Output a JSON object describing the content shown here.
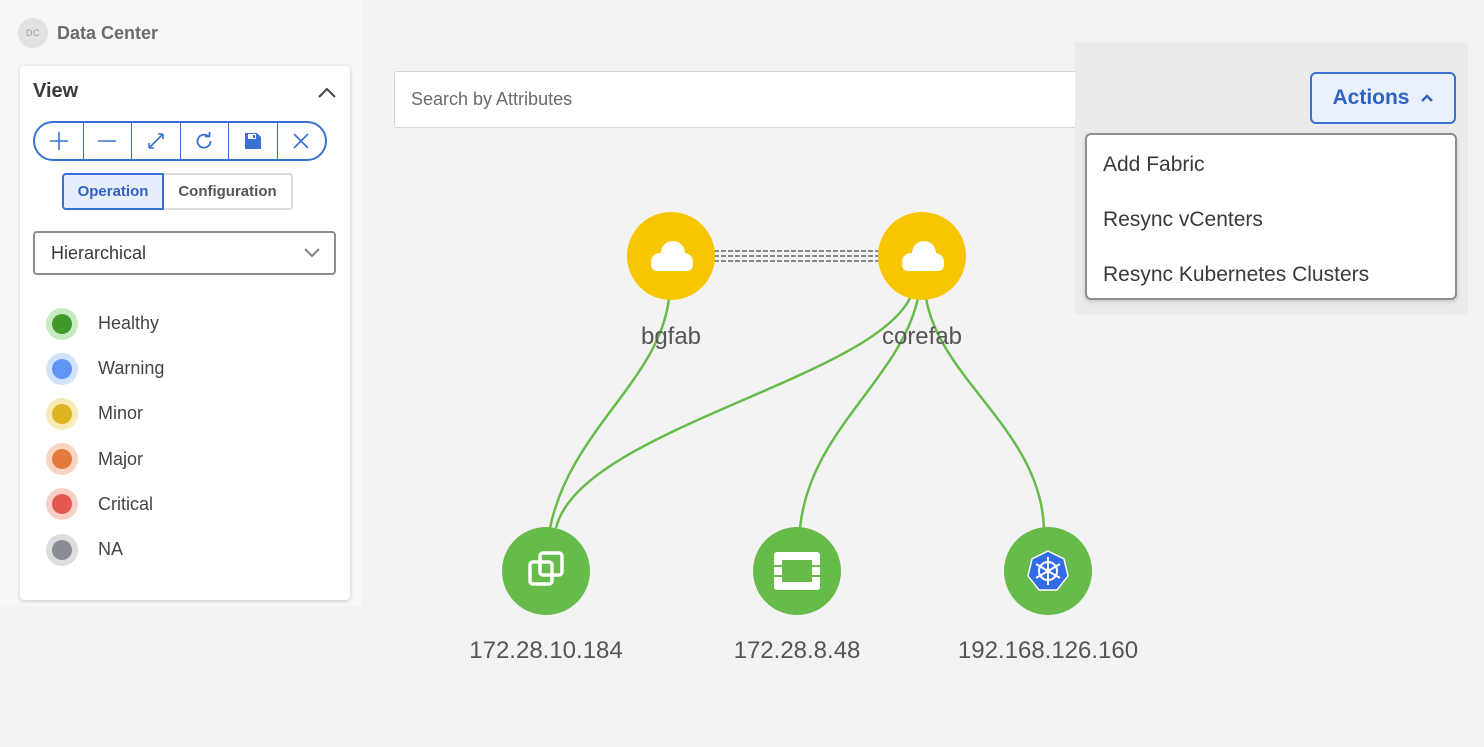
{
  "header": {
    "avatar_initials": "DC",
    "title": "Data Center"
  },
  "view_panel": {
    "title": "View",
    "toolbar": [
      "zoom-in",
      "zoom-out",
      "fit",
      "refresh",
      "save",
      "close"
    ],
    "modes": {
      "active": "Operation",
      "inactive": "Configuration"
    },
    "layout_select": "Hierarchical",
    "legend": [
      {
        "label": "Healthy",
        "color": "#3f9a2b",
        "halo": "#c8eac0"
      },
      {
        "label": "Warning",
        "color": "#5f95f4",
        "halo": "#d3e2fc"
      },
      {
        "label": "Minor",
        "color": "#dcb321",
        "halo": "#f6eab6"
      },
      {
        "label": "Major",
        "color": "#e47a3d",
        "halo": "#f6d6c3"
      },
      {
        "label": "Critical",
        "color": "#e4574a",
        "halo": "#f7d0cb"
      },
      {
        "label": "NA",
        "color": "#878c94",
        "halo": "#dcdde0"
      }
    ]
  },
  "search": {
    "placeholder": "Search by Attributes"
  },
  "actions": {
    "label": "Actions",
    "menu": [
      "Add Fabric",
      "Resync vCenters",
      "Resync Kubernetes Clusters"
    ]
  },
  "topology": {
    "fabrics": [
      {
        "name": "bgfab",
        "status": "minor",
        "icon": "cloud-icon"
      },
      {
        "name": "corefab",
        "status": "minor",
        "icon": "cloud-icon"
      }
    ],
    "hosts": [
      {
        "name": "172.28.10.184",
        "type": "vcenter",
        "icon": "vmware-icon",
        "status": "healthy"
      },
      {
        "name": "172.28.8.48",
        "type": "openstack",
        "icon": "openstack-icon",
        "status": "healthy"
      },
      {
        "name": "192.168.126.160",
        "type": "kubernetes",
        "icon": "kubernetes-icon",
        "status": "healthy"
      }
    ],
    "colors": {
      "minor": "#f7c600",
      "healthy": "#66bb4a",
      "link": "#66bb4a",
      "fabric_link": "#8a8a8a"
    }
  }
}
